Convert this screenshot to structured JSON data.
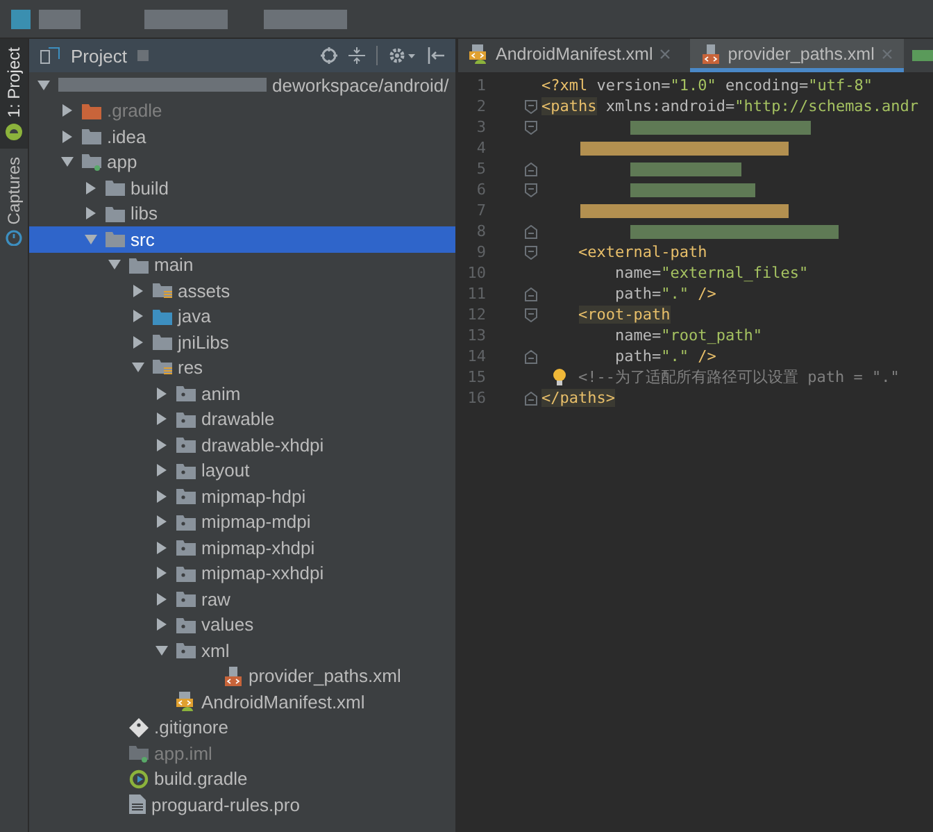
{
  "side_tabs": [
    {
      "label": "1: Project",
      "selected": true
    },
    {
      "label": "Captures",
      "selected": false
    }
  ],
  "project_panel": {
    "title": "Project",
    "tree": [
      {
        "label": "deworkspace/android/",
        "kind": "root",
        "expanded": true,
        "selected": false,
        "children": [
          {
            "label": ".gradle",
            "kind": "folder-orange",
            "expanded": false,
            "selected": false,
            "dimmed": true
          },
          {
            "label": ".idea",
            "kind": "folder",
            "expanded": false,
            "selected": false
          },
          {
            "label": "app",
            "kind": "module",
            "expanded": true,
            "selected": false,
            "children": [
              {
                "label": "build",
                "kind": "folder",
                "expanded": false,
                "selected": false
              },
              {
                "label": "libs",
                "kind": "folder",
                "expanded": false,
                "selected": false
              },
              {
                "label": "src",
                "kind": "folder",
                "expanded": true,
                "selected": true,
                "children": [
                  {
                    "label": "main",
                    "kind": "folder",
                    "expanded": true,
                    "selected": false,
                    "children": [
                      {
                        "label": "assets",
                        "kind": "folder-res",
                        "expanded": false,
                        "selected": false
                      },
                      {
                        "label": "java",
                        "kind": "folder-java",
                        "expanded": false,
                        "selected": false
                      },
                      {
                        "label": "jniLibs",
                        "kind": "folder",
                        "expanded": false,
                        "selected": false
                      },
                      {
                        "label": "res",
                        "kind": "folder-res",
                        "expanded": true,
                        "selected": false,
                        "children": [
                          {
                            "label": "anim",
                            "kind": "folder-pkg",
                            "expanded": false,
                            "selected": false
                          },
                          {
                            "label": "drawable",
                            "kind": "folder-pkg",
                            "expanded": false,
                            "selected": false
                          },
                          {
                            "label": "drawable-xhdpi",
                            "kind": "folder-pkg",
                            "expanded": false,
                            "selected": false
                          },
                          {
                            "label": "layout",
                            "kind": "folder-pkg",
                            "expanded": false,
                            "selected": false
                          },
                          {
                            "label": "mipmap-hdpi",
                            "kind": "folder-pkg",
                            "expanded": false,
                            "selected": false
                          },
                          {
                            "label": "mipmap-mdpi",
                            "kind": "folder-pkg",
                            "expanded": false,
                            "selected": false
                          },
                          {
                            "label": "mipmap-xhdpi",
                            "kind": "folder-pkg",
                            "expanded": false,
                            "selected": false
                          },
                          {
                            "label": "mipmap-xxhdpi",
                            "kind": "folder-pkg",
                            "expanded": false,
                            "selected": false
                          },
                          {
                            "label": "raw",
                            "kind": "folder-pkg",
                            "expanded": false,
                            "selected": false
                          },
                          {
                            "label": "values",
                            "kind": "folder-pkg",
                            "expanded": false,
                            "selected": false
                          },
                          {
                            "label": "xml",
                            "kind": "folder-pkg",
                            "expanded": true,
                            "selected": false,
                            "children": [
                              {
                                "label": "provider_paths.xml",
                                "kind": "xml-file",
                                "selected": false
                              }
                            ]
                          }
                        ]
                      },
                      {
                        "label": "AndroidManifest.xml",
                        "kind": "manifest",
                        "selected": false
                      }
                    ]
                  }
                ]
              },
              {
                "label": ".gitignore",
                "kind": "git",
                "selected": false
              },
              {
                "label": "app.iml",
                "kind": "iml",
                "selected": false,
                "dimmed": true
              },
              {
                "label": "build.gradle",
                "kind": "gradle",
                "selected": false
              },
              {
                "label": "proguard-rules.pro",
                "kind": "text-file",
                "selected": false
              }
            ]
          }
        ]
      }
    ]
  },
  "editor": {
    "tabs": [
      {
        "label": "AndroidManifest.xml",
        "kind": "manifest",
        "selected": false
      },
      {
        "label": "provider_paths.xml",
        "kind": "xml-file",
        "selected": true
      }
    ],
    "lines": [
      {
        "number": "1",
        "tokens": [
          {
            "text": "<?xml ",
            "kind": "tag"
          },
          {
            "text": "version=",
            "kind": "attr"
          },
          {
            "text": "\"1.0\"",
            "kind": "str"
          },
          {
            "text": " encoding=",
            "kind": "attr"
          },
          {
            "text": "\"utf-8\"",
            "kind": "str"
          }
        ]
      },
      {
        "number": "2",
        "fold_start": true,
        "tokens": [
          {
            "text": "<paths",
            "kind": "tag-hl"
          },
          {
            "text": " xmlns:android=",
            "kind": "attr"
          },
          {
            "text": "\"http://schemas.andr",
            "kind": "str"
          }
        ]
      },
      {
        "number": "3",
        "fold_start": true,
        "redacted": true
      },
      {
        "number": "4",
        "redacted": true
      },
      {
        "number": "5",
        "fold_end": true,
        "redacted": true
      },
      {
        "number": "6",
        "fold_start": true,
        "redacted": true
      },
      {
        "number": "7",
        "redacted": true
      },
      {
        "number": "8",
        "fold_end": true,
        "redacted": true
      },
      {
        "number": "9",
        "fold_start": true,
        "tokens": [
          {
            "text": "    <external-path",
            "kind": "tag"
          }
        ]
      },
      {
        "number": "10",
        "tokens": [
          {
            "text": "        name=",
            "kind": "attr"
          },
          {
            "text": "\"external_files\"",
            "kind": "str"
          }
        ]
      },
      {
        "number": "11",
        "fold_end": true,
        "tokens": [
          {
            "text": "        path=",
            "kind": "attr"
          },
          {
            "text": "\".\"",
            "kind": "str"
          },
          {
            "text": " />",
            "kind": "tag"
          }
        ]
      },
      {
        "number": "12",
        "fold_start": true,
        "tokens": [
          {
            "text": "    <root-path",
            "kind": "tag-hl"
          }
        ]
      },
      {
        "number": "13",
        "tokens": [
          {
            "text": "        name=",
            "kind": "attr"
          },
          {
            "text": "\"root_path\"",
            "kind": "str"
          }
        ]
      },
      {
        "number": "14",
        "fold_end": true,
        "tokens": [
          {
            "text": "        path=",
            "kind": "attr"
          },
          {
            "text": "\".\"",
            "kind": "str"
          },
          {
            "text": " />",
            "kind": "tag"
          }
        ]
      },
      {
        "number": "15",
        "intention": true,
        "tokens": [
          {
            "text": "    <!--为了适配所有路径可以设置 path = \".\"",
            "kind": "comment"
          }
        ]
      },
      {
        "number": "16",
        "fold_end": true,
        "tokens": [
          {
            "text": "</paths>",
            "kind": "tag-hl"
          }
        ]
      }
    ]
  }
}
